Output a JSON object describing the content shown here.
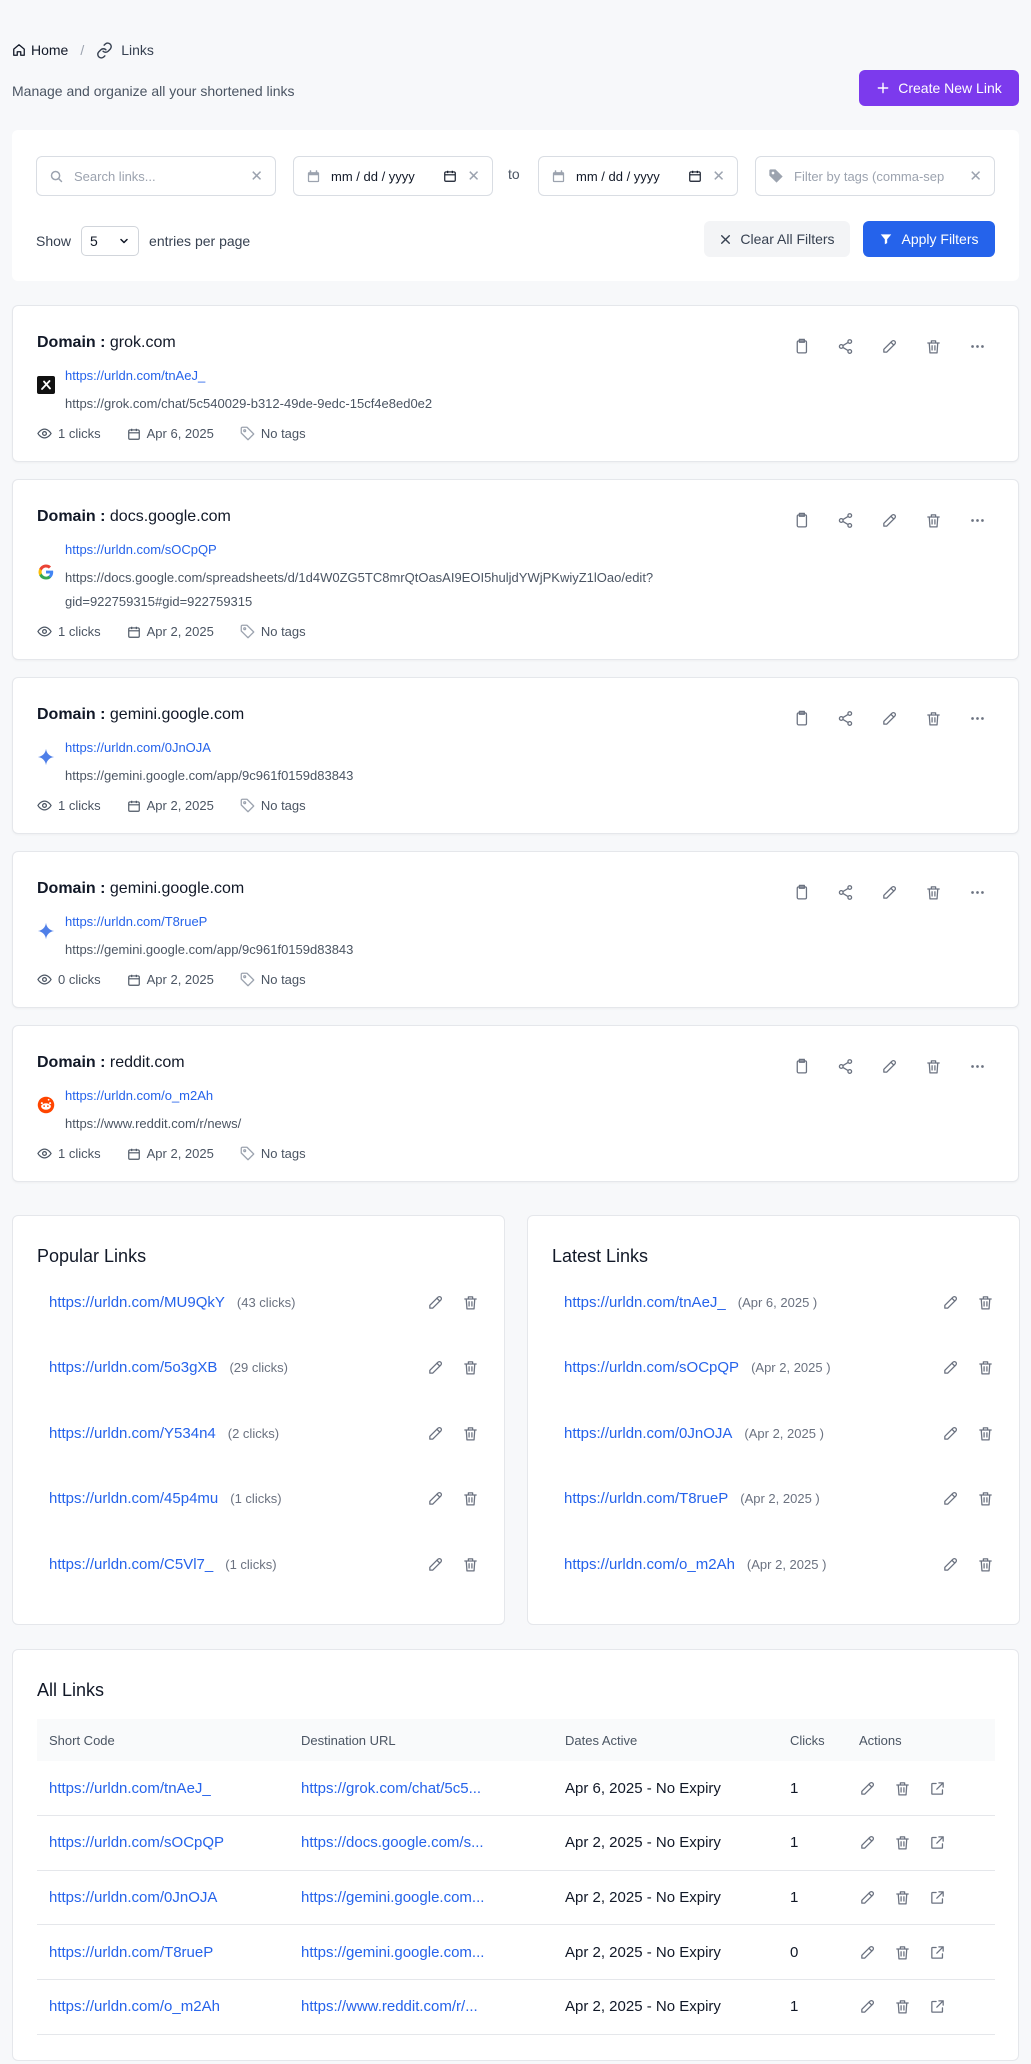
{
  "breadcrumb": {
    "home": "Home",
    "separator": "/",
    "current": "Links"
  },
  "header": {
    "subtitle": "Manage and organize all your shortened links",
    "create_button": "Create New Link"
  },
  "filters": {
    "search_placeholder": "Search links...",
    "date_from": "mm / dd / yyyy",
    "to_label": "to",
    "date_to": "mm / dd / yyyy",
    "tags_placeholder": "Filter by tags (comma-sep",
    "show_label": "Show",
    "entries_value": "5",
    "entries_label": "entries per page",
    "clear_button": "Clear All Filters",
    "apply_button": "Apply Filters"
  },
  "colors": {
    "primary": "#2563eb",
    "accent": "#7c3aed"
  },
  "link_cards": [
    {
      "domain_label": "Domain :",
      "domain": "grok.com",
      "favicon": "grok-icon",
      "short": "https://urldn.com/tnAeJ_",
      "dest": "https://grok.com/chat/5c540029-b312-49de-9edc-15cf4e8ed0e2",
      "clicks": "1 clicks",
      "date": "Apr 6, 2025",
      "tags": "No tags"
    },
    {
      "domain_label": "Domain :",
      "domain": "docs.google.com",
      "favicon": "google-icon",
      "short": "https://urldn.com/sOCpQP",
      "dest": "https://docs.google.com/spreadsheets/d/1d4W0ZG5TC8mrQtOasAI9EOI5huljdYWjPKwiyZ1lOao/edit?gid=922759315#gid=922759315",
      "clicks": "1 clicks",
      "date": "Apr 2, 2025",
      "tags": "No tags"
    },
    {
      "domain_label": "Domain :",
      "domain": "gemini.google.com",
      "favicon": "gemini-icon",
      "short": "https://urldn.com/0JnOJA",
      "dest": "https://gemini.google.com/app/9c961f0159d83843",
      "clicks": "1 clicks",
      "date": "Apr 2, 2025",
      "tags": "No tags"
    },
    {
      "domain_label": "Domain :",
      "domain": "gemini.google.com",
      "favicon": "gemini-icon",
      "short": "https://urldn.com/T8rueP",
      "dest": "https://gemini.google.com/app/9c961f0159d83843",
      "clicks": "0 clicks",
      "date": "Apr 2, 2025",
      "tags": "No tags"
    },
    {
      "domain_label": "Domain :",
      "domain": "reddit.com",
      "favicon": "reddit-icon",
      "short": "https://urldn.com/o_m2Ah",
      "dest": "https://www.reddit.com/r/news/",
      "clicks": "1 clicks",
      "date": "Apr 2, 2025",
      "tags": "No tags"
    }
  ],
  "popular": {
    "title": "Popular Links",
    "items": [
      {
        "link": "https://urldn.com/MU9QkY",
        "meta": "(43 clicks)"
      },
      {
        "link": "https://urldn.com/5o3gXB",
        "meta": "(29 clicks)"
      },
      {
        "link": "https://urldn.com/Y534n4",
        "meta": "(2 clicks)"
      },
      {
        "link": "https://urldn.com/45p4mu",
        "meta": "(1 clicks)"
      },
      {
        "link": "https://urldn.com/C5Vl7_",
        "meta": "(1 clicks)"
      }
    ]
  },
  "latest": {
    "title": "Latest Links",
    "items": [
      {
        "link": "https://urldn.com/tnAeJ_",
        "meta": "(Apr 6, 2025 )"
      },
      {
        "link": "https://urldn.com/sOCpQP",
        "meta": "(Apr 2, 2025 )"
      },
      {
        "link": "https://urldn.com/0JnOJA",
        "meta": "(Apr 2, 2025 )"
      },
      {
        "link": "https://urldn.com/T8rueP",
        "meta": "(Apr 2, 2025 )"
      },
      {
        "link": "https://urldn.com/o_m2Ah",
        "meta": "(Apr 2, 2025 )"
      }
    ]
  },
  "all_links": {
    "title": "All Links",
    "headers": [
      "Short Code",
      "Destination URL",
      "Dates Active",
      "Clicks",
      "Actions"
    ],
    "rows": [
      {
        "short": "https://urldn.com/tnAeJ_",
        "dest": "https://grok.com/chat/5c5...",
        "dates": "Apr 6, 2025 - No Expiry",
        "clicks": "1"
      },
      {
        "short": "https://urldn.com/sOCpQP",
        "dest": "https://docs.google.com/s...",
        "dates": "Apr 2, 2025 - No Expiry",
        "clicks": "1"
      },
      {
        "short": "https://urldn.com/0JnOJA",
        "dest": "https://gemini.google.com...",
        "dates": "Apr 2, 2025 - No Expiry",
        "clicks": "1"
      },
      {
        "short": "https://urldn.com/T8rueP",
        "dest": "https://gemini.google.com...",
        "dates": "Apr 2, 2025 - No Expiry",
        "clicks": "0"
      },
      {
        "short": "https://urldn.com/o_m2Ah",
        "dest": "https://www.reddit.com/r/...",
        "dates": "Apr 2, 2025 - No Expiry",
        "clicks": "1"
      }
    ]
  }
}
